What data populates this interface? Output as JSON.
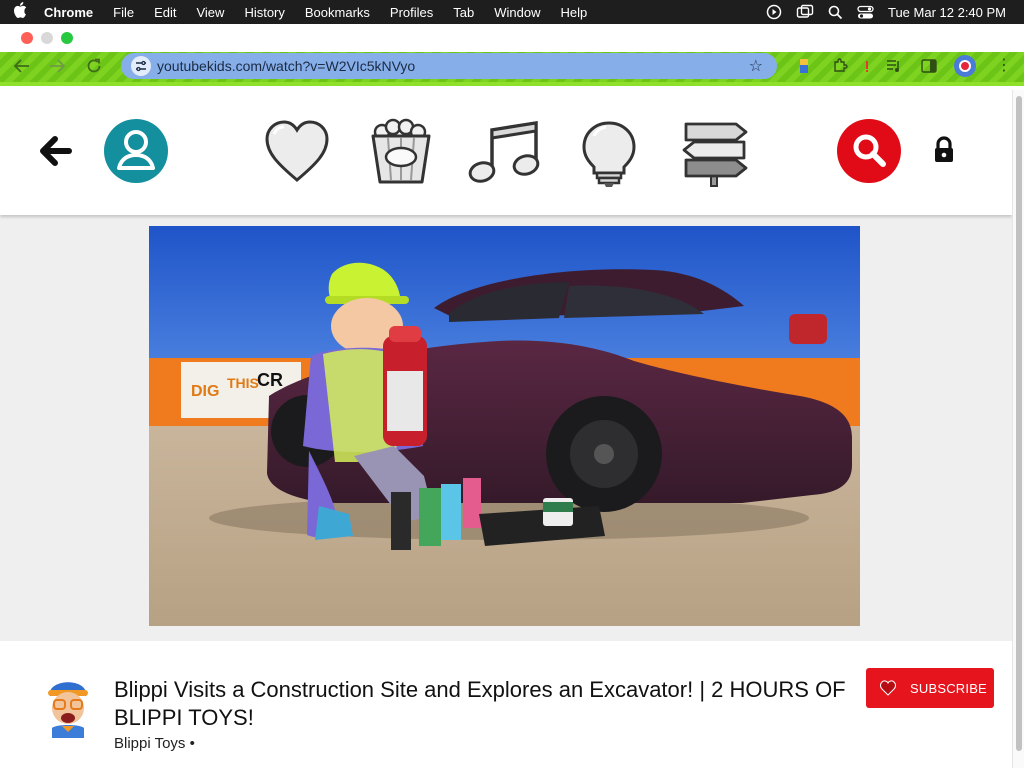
{
  "menubar": {
    "app_name": "Chrome",
    "items": [
      "File",
      "Edit",
      "View",
      "History",
      "Bookmarks",
      "Profiles",
      "Tab",
      "Window",
      "Help"
    ],
    "clock": "Tue Mar 12  2:40 PM"
  },
  "browser": {
    "url": "youtubekids.com/watch?v=W2VIc5kNVyo",
    "theme_color": "#7ed321",
    "url_bar_color": "#86aee8"
  },
  "header": {
    "nav_icons": [
      "back-arrow-icon",
      "profile-icon",
      "heart-icon",
      "popcorn-icon",
      "music-icon",
      "lightbulb-icon",
      "signpost-icon",
      "search-icon",
      "lock-icon"
    ],
    "accent_teal": "#138f9e",
    "accent_red": "#e00b16"
  },
  "video": {
    "title": "Blippi Visits a Construction Site and Explores an Excavator! | 2 HOURS OF BLIPPI TOYS!",
    "channel": "Blippi Toys •",
    "subscribe_label": "SUBSCRIBE",
    "subscribe_color": "#e6141d"
  }
}
